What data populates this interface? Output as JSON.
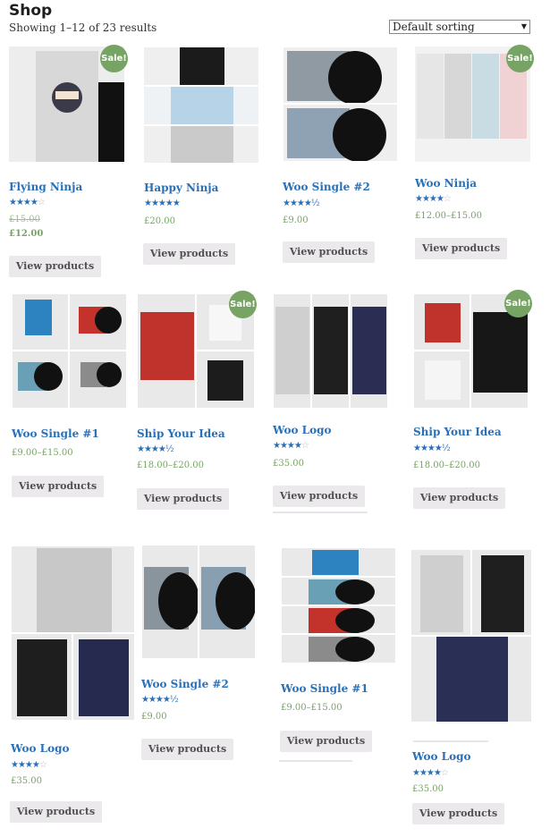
{
  "page": {
    "title": "Shop",
    "result_count": "Showing 1–12 of 23 results"
  },
  "sort": {
    "selected": "Default sorting"
  },
  "colors": {
    "link": "#2a70b8",
    "price": "#77a464",
    "sale_badge": "#77a464",
    "button_bg": "#ebe9eb"
  },
  "products": [
    {
      "title": "Flying Ninja",
      "rating": 4,
      "old_price": "£15.00",
      "price": "£12.00",
      "sale": "Sale!",
      "button": "View products"
    },
    {
      "title": "Happy Ninja",
      "rating": 5,
      "price": "£20.00",
      "button": "View products"
    },
    {
      "title": "Woo Single #2",
      "rating": 4.5,
      "price": "£9.00",
      "button": "View products"
    },
    {
      "title": "Woo Ninja",
      "rating": 4,
      "price": "£12.00–£15.00",
      "sale": "Sale!",
      "button": "View products"
    },
    {
      "title": "Woo Single #1",
      "price": "£9.00–£15.00",
      "button": "View products"
    },
    {
      "title": "Ship Your Idea",
      "rating": 4.5,
      "price": "£18.00–£20.00",
      "sale": "Sale!",
      "button": "View products"
    },
    {
      "title": "Woo Logo",
      "rating": 4,
      "price": "£35.00",
      "button": "View products"
    },
    {
      "title": "Ship Your Idea",
      "rating": 4.5,
      "price": "£18.00–£20.00",
      "sale": "Sale!",
      "button": "View products"
    },
    {
      "title": "Woo Logo",
      "rating": 4,
      "price": "£35.00",
      "button": "View products"
    },
    {
      "title": "Woo Single #2",
      "rating": 4.5,
      "price": "£9.00",
      "button": "View products"
    },
    {
      "title": "Woo Single #1",
      "price": "£9.00–£15.00",
      "button": "View products"
    },
    {
      "title": "Woo Logo",
      "rating": 4,
      "price": "£35.00",
      "button": "View products"
    }
  ]
}
